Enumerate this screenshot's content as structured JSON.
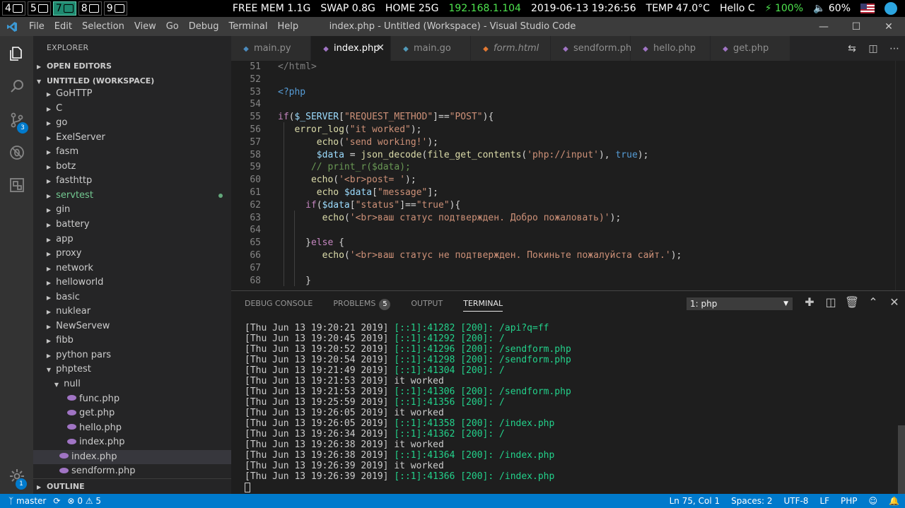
{
  "system_bar": {
    "workspaces": [
      {
        "num": "4",
        "icon": "chat-icon"
      },
      {
        "num": "5",
        "icon": "image-icon"
      },
      {
        "num": "7",
        "icon": "terminal-icon",
        "active": true
      },
      {
        "num": "8",
        "icon": "code-icon"
      },
      {
        "num": "9",
        "icon": "window-icon"
      }
    ],
    "free_mem": "FREE MEM 1.1G",
    "swap": "SWAP 0.8G",
    "home": "HOME 25G",
    "ip": "192.168.1.104",
    "datetime": "2019-06-13 19:26:56",
    "temp": "TEMP 47.0°C",
    "greeting": "Hello C",
    "battery": "⚡ 100%",
    "volume": "🔈 60%"
  },
  "titlebar": {
    "menu": [
      "File",
      "Edit",
      "Selection",
      "View",
      "Go",
      "Debug",
      "Terminal",
      "Help"
    ],
    "title": "index.php - Untitled (Workspace) - Visual Studio Code"
  },
  "activity": {
    "scm_badge": "3",
    "settings_badge": "1"
  },
  "sidebar": {
    "title": "EXPLORER",
    "open_editors": "OPEN EDITORS",
    "workspace": "UNTITLED (WORKSPACE)",
    "tree": [
      {
        "label": "GoHTTP",
        "depth": 0
      },
      {
        "label": "C",
        "depth": 0
      },
      {
        "label": "go",
        "depth": 0
      },
      {
        "label": "ExelServer",
        "depth": 0
      },
      {
        "label": "fasm",
        "depth": 0
      },
      {
        "label": "botz",
        "depth": 0
      },
      {
        "label": "fasthttp",
        "depth": 0
      },
      {
        "label": "servtest",
        "depth": 0,
        "git": true
      },
      {
        "label": "gin",
        "depth": 0
      },
      {
        "label": "battery",
        "depth": 0
      },
      {
        "label": "app",
        "depth": 0
      },
      {
        "label": "proxy",
        "depth": 0
      },
      {
        "label": "network",
        "depth": 0
      },
      {
        "label": "helloworld",
        "depth": 0
      },
      {
        "label": "basic",
        "depth": 0
      },
      {
        "label": "nuklear",
        "depth": 0
      },
      {
        "label": "NewServew",
        "depth": 0
      },
      {
        "label": "fibb",
        "depth": 0
      },
      {
        "label": "python pars",
        "depth": 0
      },
      {
        "label": "phptest",
        "depth": 0,
        "open": true
      },
      {
        "label": "null",
        "depth": 1,
        "open": true
      },
      {
        "label": "func.php",
        "depth": 2,
        "file": true
      },
      {
        "label": "get.php",
        "depth": 2,
        "file": true
      },
      {
        "label": "hello.php",
        "depth": 2,
        "file": true
      },
      {
        "label": "index.php",
        "depth": 2,
        "file": true
      },
      {
        "label": "index.php",
        "depth": 1,
        "file": true,
        "selected": true
      },
      {
        "label": "sendform.php",
        "depth": 1,
        "file": true
      }
    ],
    "outline": "OUTLINE"
  },
  "tabs": [
    {
      "label": "main.py",
      "icon": "python-icon",
      "color": "#4b8bbe"
    },
    {
      "label": "index.php",
      "icon": "php-icon",
      "color": "#a074c4",
      "active": true
    },
    {
      "label": "main.go",
      "icon": "go-icon",
      "color": "#519aba"
    },
    {
      "label": "form.html",
      "icon": "html-icon",
      "color": "#e37933",
      "italic": true
    },
    {
      "label": "sendform.php",
      "icon": "php-icon",
      "color": "#a074c4"
    },
    {
      "label": "hello.php",
      "icon": "php-icon",
      "color": "#a074c4"
    },
    {
      "label": "get.php",
      "icon": "php-icon",
      "color": "#a074c4"
    }
  ],
  "editor": {
    "lines": [
      {
        "n": "51",
        "indent": 0,
        "tokens": [
          [
            "t-tag",
            "</html>"
          ]
        ]
      },
      {
        "n": "52",
        "indent": 0,
        "tokens": []
      },
      {
        "n": "53",
        "indent": 0,
        "tokens": [
          [
            "t-kw",
            "<?php"
          ]
        ]
      },
      {
        "n": "54",
        "indent": 0,
        "tokens": []
      },
      {
        "n": "55",
        "indent": 0,
        "tokens": [
          [
            "t-ctrl",
            "if"
          ],
          [
            "t-pun",
            "("
          ],
          [
            "t-var",
            "$_SERVER"
          ],
          [
            "t-pun",
            "["
          ],
          [
            "t-str",
            "\"REQUEST_METHOD\""
          ],
          [
            "t-pun",
            "]=="
          ],
          [
            "t-str",
            "\"POST\""
          ],
          [
            "t-pun",
            "){"
          ]
        ]
      },
      {
        "n": "56",
        "indent": 3,
        "tokens": [
          [
            "t-fn",
            "error_log"
          ],
          [
            "t-pun",
            "("
          ],
          [
            "t-str",
            "\"it worked\""
          ],
          [
            "t-pun",
            ");"
          ]
        ]
      },
      {
        "n": "57",
        "indent": 7,
        "tokens": [
          [
            "t-fn",
            "echo"
          ],
          [
            "t-pun",
            "("
          ],
          [
            "t-str",
            "'send working!'"
          ],
          [
            "t-pun",
            ");"
          ]
        ]
      },
      {
        "n": "58",
        "indent": 7,
        "tokens": [
          [
            "t-var",
            "$data"
          ],
          [
            "t-pun",
            " = "
          ],
          [
            "t-fn",
            "json_decode"
          ],
          [
            "t-pun",
            "("
          ],
          [
            "t-fn",
            "file_get_contents"
          ],
          [
            "t-pun",
            "("
          ],
          [
            "t-str",
            "'php://input'"
          ],
          [
            "t-pun",
            "), "
          ],
          [
            "t-kw",
            "true"
          ],
          [
            "t-pun",
            ");"
          ]
        ]
      },
      {
        "n": "59",
        "indent": 6,
        "tokens": [
          [
            "t-com",
            "// print_r($data);"
          ]
        ]
      },
      {
        "n": "60",
        "indent": 6,
        "tokens": [
          [
            "t-fn",
            "echo"
          ],
          [
            "t-pun",
            "("
          ],
          [
            "t-str",
            "'<br>post= '"
          ],
          [
            "t-pun",
            ");"
          ]
        ]
      },
      {
        "n": "61",
        "indent": 7,
        "tokens": [
          [
            "t-fn",
            "echo"
          ],
          [
            "t-pun",
            " "
          ],
          [
            "t-var",
            "$data"
          ],
          [
            "t-pun",
            "["
          ],
          [
            "t-str",
            "\"message\""
          ],
          [
            "t-pun",
            "];"
          ]
        ]
      },
      {
        "n": "62",
        "indent": 5,
        "tokens": [
          [
            "t-ctrl",
            "if"
          ],
          [
            "t-pun",
            "("
          ],
          [
            "t-var",
            "$data"
          ],
          [
            "t-pun",
            "["
          ],
          [
            "t-str",
            "\"status\""
          ],
          [
            "t-pun",
            "]=="
          ],
          [
            "t-str",
            "\"true\""
          ],
          [
            "t-pun",
            "){"
          ]
        ]
      },
      {
        "n": "63",
        "indent": 8,
        "tokens": [
          [
            "t-fn",
            "echo"
          ],
          [
            "t-pun",
            "("
          ],
          [
            "t-str",
            "'<br>ваш статус подтвержден. Добро пожаловать)'"
          ],
          [
            "t-pun",
            ");"
          ]
        ]
      },
      {
        "n": "64",
        "indent": 0,
        "tokens": []
      },
      {
        "n": "65",
        "indent": 5,
        "tokens": [
          [
            "t-pun",
            "}"
          ],
          [
            "t-ctrl",
            "else"
          ],
          [
            "t-pun",
            " {"
          ]
        ]
      },
      {
        "n": "66",
        "indent": 8,
        "tokens": [
          [
            "t-fn",
            "echo"
          ],
          [
            "t-pun",
            "("
          ],
          [
            "t-str",
            "'<br>ваш статус не подтвержден. Покиньте пожалуйста сайт.'"
          ],
          [
            "t-pun",
            ");"
          ]
        ]
      },
      {
        "n": "67",
        "indent": 0,
        "tokens": []
      },
      {
        "n": "68",
        "indent": 5,
        "tokens": [
          [
            "t-pun",
            "}"
          ]
        ]
      }
    ]
  },
  "panel": {
    "tabs": [
      {
        "label": "DEBUG CONSOLE"
      },
      {
        "label": "PROBLEMS",
        "badge": "5"
      },
      {
        "label": "OUTPUT"
      },
      {
        "label": "TERMINAL",
        "active": true
      }
    ],
    "terminal_select": "1: php",
    "terminal_lines": [
      {
        "date": "[Thu Jun 13 19:20:21 2019]",
        "addr": "[::1]:41282 [200]: /api?q=ff"
      },
      {
        "date": "[Thu Jun 13 19:20:45 2019]",
        "addr": "[::1]:41292 [200]: /"
      },
      {
        "date": "[Thu Jun 13 19:20:52 2019]",
        "addr": "[::1]:41296 [200]: /sendform.php"
      },
      {
        "date": "[Thu Jun 13 19:20:54 2019]",
        "addr": "[::1]:41298 [200]: /sendform.php"
      },
      {
        "date": "[Thu Jun 13 19:21:49 2019]",
        "addr": "[::1]:41304 [200]: /"
      },
      {
        "date": "[Thu Jun 13 19:21:53 2019]",
        "msg": "it worked"
      },
      {
        "date": "[Thu Jun 13 19:21:53 2019]",
        "addr": "[::1]:41306 [200]: /sendform.php"
      },
      {
        "date": "[Thu Jun 13 19:25:59 2019]",
        "addr": "[::1]:41356 [200]: /"
      },
      {
        "date": "[Thu Jun 13 19:26:05 2019]",
        "msg": "it worked"
      },
      {
        "date": "[Thu Jun 13 19:26:05 2019]",
        "addr": "[::1]:41358 [200]: /index.php"
      },
      {
        "date": "[Thu Jun 13 19:26:34 2019]",
        "addr": "[::1]:41362 [200]: /"
      },
      {
        "date": "[Thu Jun 13 19:26:38 2019]",
        "msg": "it worked"
      },
      {
        "date": "[Thu Jun 13 19:26:38 2019]",
        "addr": "[::1]:41364 [200]: /index.php"
      },
      {
        "date": "[Thu Jun 13 19:26:39 2019]",
        "msg": "it worked"
      },
      {
        "date": "[Thu Jun 13 19:26:39 2019]",
        "addr": "[::1]:41366 [200]: /index.php"
      }
    ]
  },
  "statusbar": {
    "branch": "master",
    "errors": "0",
    "warnings": "5",
    "position": "Ln 75, Col 1",
    "spaces": "Spaces: 2",
    "encoding": "UTF-8",
    "eol": "LF",
    "language": "PHP"
  }
}
